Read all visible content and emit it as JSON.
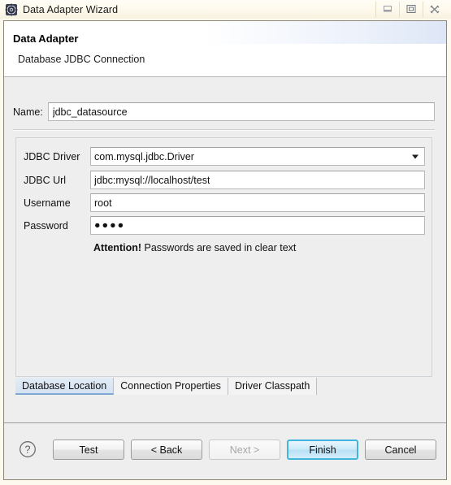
{
  "window": {
    "title": "Data Adapter Wizard",
    "icon": "app-gear-icon",
    "controls": [
      {
        "name": "minimize-button",
        "glyph": "minimize"
      },
      {
        "name": "maximize-button",
        "glyph": "restore"
      },
      {
        "name": "close-button",
        "glyph": "close"
      }
    ]
  },
  "header": {
    "title": "Data Adapter",
    "subtitle": "Database JDBC Connection"
  },
  "form": {
    "name_label": "Name:",
    "name_value": "jdbc_datasource",
    "fields": [
      {
        "label": "JDBC Driver",
        "value": "com.mysql.jdbc.Driver",
        "type": "combobox"
      },
      {
        "label": "JDBC Url",
        "value": "jdbc:mysql://localhost/test",
        "type": "text"
      },
      {
        "label": "Username",
        "value": "root",
        "type": "text"
      },
      {
        "label": "Password",
        "value": "●●●●",
        "type": "password"
      }
    ],
    "attention_bold": "Attention!",
    "attention_text": "Passwords are saved in clear text"
  },
  "tabs": [
    {
      "label": "Database Location",
      "selected": true
    },
    {
      "label": "Connection Properties",
      "selected": false
    },
    {
      "label": "Driver Classpath",
      "selected": false
    }
  ],
  "buttons": [
    {
      "label": "Test",
      "state": "enabled"
    },
    {
      "label": "< Back",
      "state": "enabled"
    },
    {
      "label": "Next >",
      "state": "disabled"
    },
    {
      "label": "Finish",
      "state": "default"
    },
    {
      "label": "Cancel",
      "state": "enabled"
    }
  ],
  "help": {
    "icon": "help-question-icon"
  },
  "colors": {
    "titlebar": "#fdf8ea",
    "dialog_bg": "#eeeeee",
    "header_bg": "#ffffff",
    "accent_focus": "#41b6dd",
    "tab_selected": "#d4e2f2",
    "field_bg": "#ffffff"
  }
}
